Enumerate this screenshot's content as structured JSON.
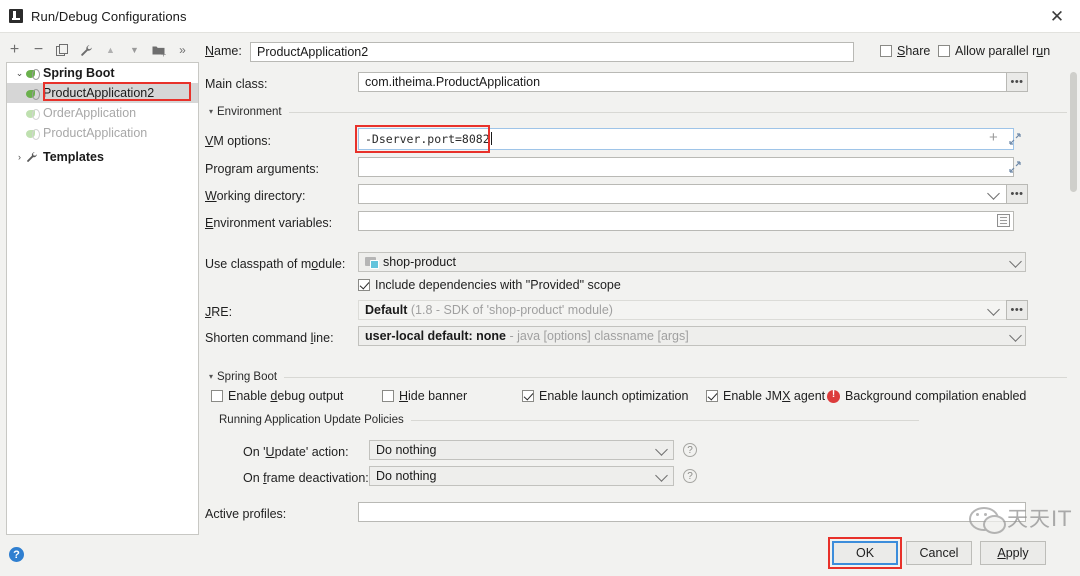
{
  "window": {
    "title": "Run/Debug Configurations",
    "app_icon": "intellij-idea-icon",
    "close_label": "✕"
  },
  "toolbar": {
    "items": [
      {
        "name": "add-configuration-button",
        "glyph": "+",
        "label": "Add New Configuration"
      },
      {
        "name": "remove-configuration-button",
        "glyph": "−",
        "label": "Remove Configuration"
      },
      {
        "name": "copy-configuration-button",
        "glyph": "copy",
        "label": "Copy Configuration"
      },
      {
        "name": "edit-templates-button",
        "glyph": "wrench",
        "label": "Edit Templates"
      },
      {
        "name": "move-up-button",
        "glyph": "▲",
        "label": "Move Up"
      },
      {
        "name": "move-down-button",
        "glyph": "▼",
        "label": "Move Down"
      },
      {
        "name": "move-into-folder-button",
        "glyph": "folder",
        "label": "Move Into New Folder"
      },
      {
        "name": "more-options-button",
        "glyph": "»",
        "label": "More"
      }
    ]
  },
  "tree": {
    "root": {
      "label": "Spring Boot",
      "expanded_arrow": "⌄",
      "icon": "spring-boot-icon"
    },
    "children": [
      {
        "label": "ProductApplication2",
        "icon": "spring-boot-icon",
        "selected": true,
        "muted": false
      },
      {
        "label": "OrderApplication",
        "icon": "spring-boot-icon",
        "selected": false,
        "muted": true
      },
      {
        "label": "ProductApplication",
        "icon": "spring-boot-icon",
        "selected": false,
        "muted": true
      }
    ],
    "templates": {
      "label": "Templates",
      "collapsed_arrow": "›",
      "icon": "wrench-icon"
    }
  },
  "name_row": {
    "label": "Name:",
    "label_mnemonic": "N",
    "value": "ProductApplication2",
    "share": {
      "label": "Share",
      "checked": false
    },
    "allow_parallel_run": {
      "label": "Allow parallel run",
      "checked": false
    }
  },
  "form": {
    "main_class": {
      "label": "Main class:",
      "value": "com.itheima.ProductApplication",
      "browse": "•••"
    },
    "environment_section": {
      "label": "Environment",
      "arrow": "▾"
    },
    "vm_options": {
      "label": "VM options:",
      "value": "-Dserver.port=8082",
      "highlighted": true,
      "add_glyph": "+",
      "expand_glyph": "expand-icon"
    },
    "program_arguments": {
      "label": "Program arguments:",
      "value": "",
      "expand_glyph": "expand-icon"
    },
    "working_directory": {
      "label": "Working directory:",
      "value": "",
      "browse": "•••",
      "chevron": "chevron-down-icon"
    },
    "environment_variables": {
      "label": "Environment variables:",
      "value": "",
      "editor_glyph": "document-icon"
    },
    "use_classpath_of_module": {
      "label": "Use classpath of module:",
      "value": "shop-product",
      "icon": "module-icon",
      "chevron": "chevron-down-icon"
    },
    "include_provided": {
      "label": "Include dependencies with \"Provided\" scope",
      "checked": true
    },
    "jre": {
      "label": "JRE:",
      "value": "Default",
      "hint": "(1.8 - SDK of 'shop-product' module)",
      "browse": "•••",
      "chevron": "chevron-down-icon"
    },
    "shorten_command_line": {
      "label": "Shorten command line:",
      "value": "user-local default: none",
      "hint": "- java [options] classname [args]",
      "chevron": "chevron-down-icon"
    }
  },
  "spring_boot_section": {
    "title": "Spring Boot",
    "arrow": "▾",
    "checkboxes": [
      {
        "label": "Enable debug output",
        "checked": false
      },
      {
        "label": "Hide banner",
        "checked": false
      },
      {
        "label": "Enable launch optimization",
        "checked": true
      },
      {
        "label": "Enable JMX agent",
        "checked": true
      }
    ],
    "warning": {
      "label": "Background compilation enabled",
      "icon": "warning-icon",
      "color": "#dc3c3c"
    }
  },
  "update_policies": {
    "title": "Running Application Update Policies",
    "rows": [
      {
        "label": "On 'Update' action:",
        "value": "Do nothing",
        "help": "?"
      },
      {
        "label": "On frame deactivation:",
        "value": "Do nothing",
        "help": "?"
      }
    ]
  },
  "active_profiles": {
    "label": "Active profiles:",
    "value": ""
  },
  "footer": {
    "help_icon": "?",
    "buttons": [
      {
        "name": "ok-button",
        "label": "OK",
        "default": true,
        "highlighted": true
      },
      {
        "name": "cancel-button",
        "label": "Cancel",
        "default": false,
        "highlighted": false
      },
      {
        "name": "apply-button",
        "label": "Apply",
        "default": false,
        "highlighted": false
      }
    ]
  },
  "watermark": {
    "text": "天天IT",
    "icon": "wechat-icon"
  },
  "colors": {
    "highlight_red": "#e8312a",
    "focus_blue": "#3c8ddb",
    "selection_gray": "#d6d6d6",
    "warning_red": "#dc3c3c",
    "dialog_bg": "#f2f2f0"
  }
}
